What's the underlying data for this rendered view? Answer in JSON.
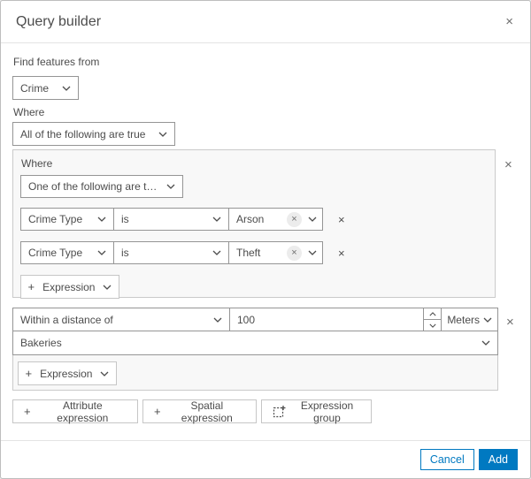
{
  "dialog": {
    "title": "Query builder"
  },
  "icons": {
    "close": "×",
    "remove": "×",
    "plus": "+"
  },
  "colors": {
    "accent": "#0079c1",
    "group_bg": "#f8f8f8",
    "input_border": "#959595",
    "group_border": "#cacaca"
  },
  "find_features": {
    "label": "Find features from",
    "selected": "Crime"
  },
  "where": {
    "label": "Where",
    "selected": "All of the following are true"
  },
  "attribute_group": {
    "label": "Where",
    "operator": "One of the following are tr…",
    "rows": [
      {
        "field": "Crime Type",
        "operator": "is",
        "value": "Arson"
      },
      {
        "field": "Crime Type",
        "operator": "is",
        "value": "Theft"
      }
    ],
    "add_expression_label": "Expression"
  },
  "spatial_group": {
    "operator": "Within a distance of",
    "distance": "100",
    "units": "Meters",
    "layer": "Bakeries",
    "add_expression_label": "Expression"
  },
  "actions": {
    "attribute_expression": "Attribute expression",
    "spatial_expression": "Spatial expression",
    "expression_group": "Expression group"
  },
  "footer": {
    "cancel": "Cancel",
    "add": "Add"
  }
}
